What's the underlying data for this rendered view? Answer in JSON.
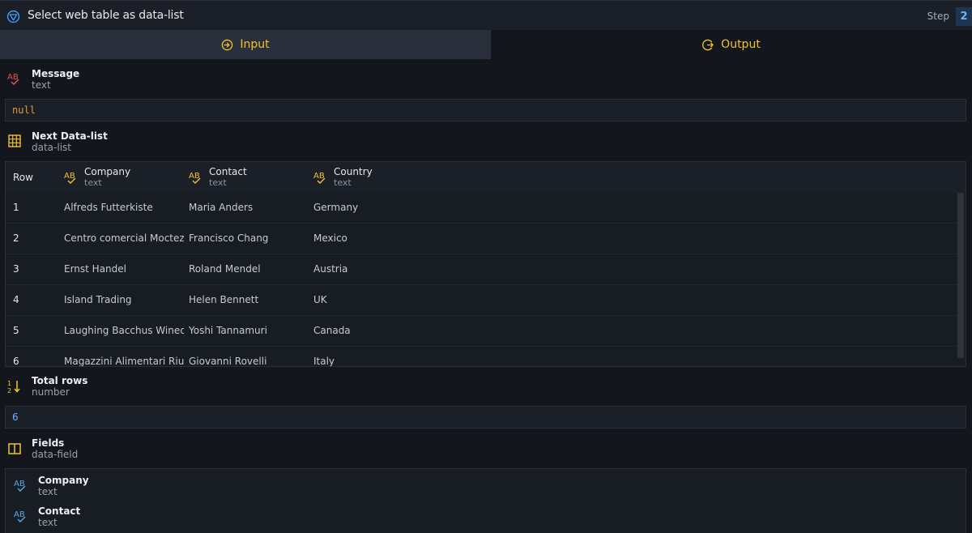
{
  "titlebar": {
    "title": "Select web table as data-list",
    "step_label": "Step",
    "step_number": "2"
  },
  "tabs": [
    {
      "label": "Input",
      "icon": "arrow-in-circle-icon"
    },
    {
      "label": "Output",
      "icon": "arrow-out-circle-icon"
    }
  ],
  "message": {
    "name": "Message",
    "type": "text",
    "value": "null"
  },
  "next_data_list": {
    "name": "Next Data-list",
    "type": "data-list",
    "row_header": "Row",
    "columns": [
      {
        "name": "Company",
        "type": "text"
      },
      {
        "name": "Contact",
        "type": "text"
      },
      {
        "name": "Country",
        "type": "text"
      }
    ],
    "rows": [
      {
        "row": "1",
        "company": "Alfreds Futterkiste",
        "contact": "Maria Anders",
        "country": "Germany"
      },
      {
        "row": "2",
        "company": "Centro comercial Moctezuma",
        "contact": "Francisco Chang",
        "country": "Mexico"
      },
      {
        "row": "3",
        "company": "Ernst Handel",
        "contact": "Roland Mendel",
        "country": "Austria"
      },
      {
        "row": "4",
        "company": "Island Trading",
        "contact": "Helen Bennett",
        "country": "UK"
      },
      {
        "row": "5",
        "company": "Laughing Bacchus Winecellars",
        "contact": "Yoshi Tannamuri",
        "country": "Canada"
      },
      {
        "row": "6",
        "company": "Magazzini Alimentari Riuniti",
        "contact": "Giovanni Rovelli",
        "country": "Italy"
      }
    ]
  },
  "total_rows": {
    "name": "Total rows",
    "type": "number",
    "value": "6"
  },
  "fields": {
    "name": "Fields",
    "type": "data-field",
    "items": [
      {
        "name": "Company",
        "type": "text"
      },
      {
        "name": "Contact",
        "type": "text"
      }
    ]
  },
  "colors": {
    "accent": "#f2c230",
    "text_type_icon_red": "#e2545a",
    "field_icon_blue": "#5aa9e6",
    "number_blue": "#6fb5ff",
    "null_orange": "#e39a3b"
  }
}
